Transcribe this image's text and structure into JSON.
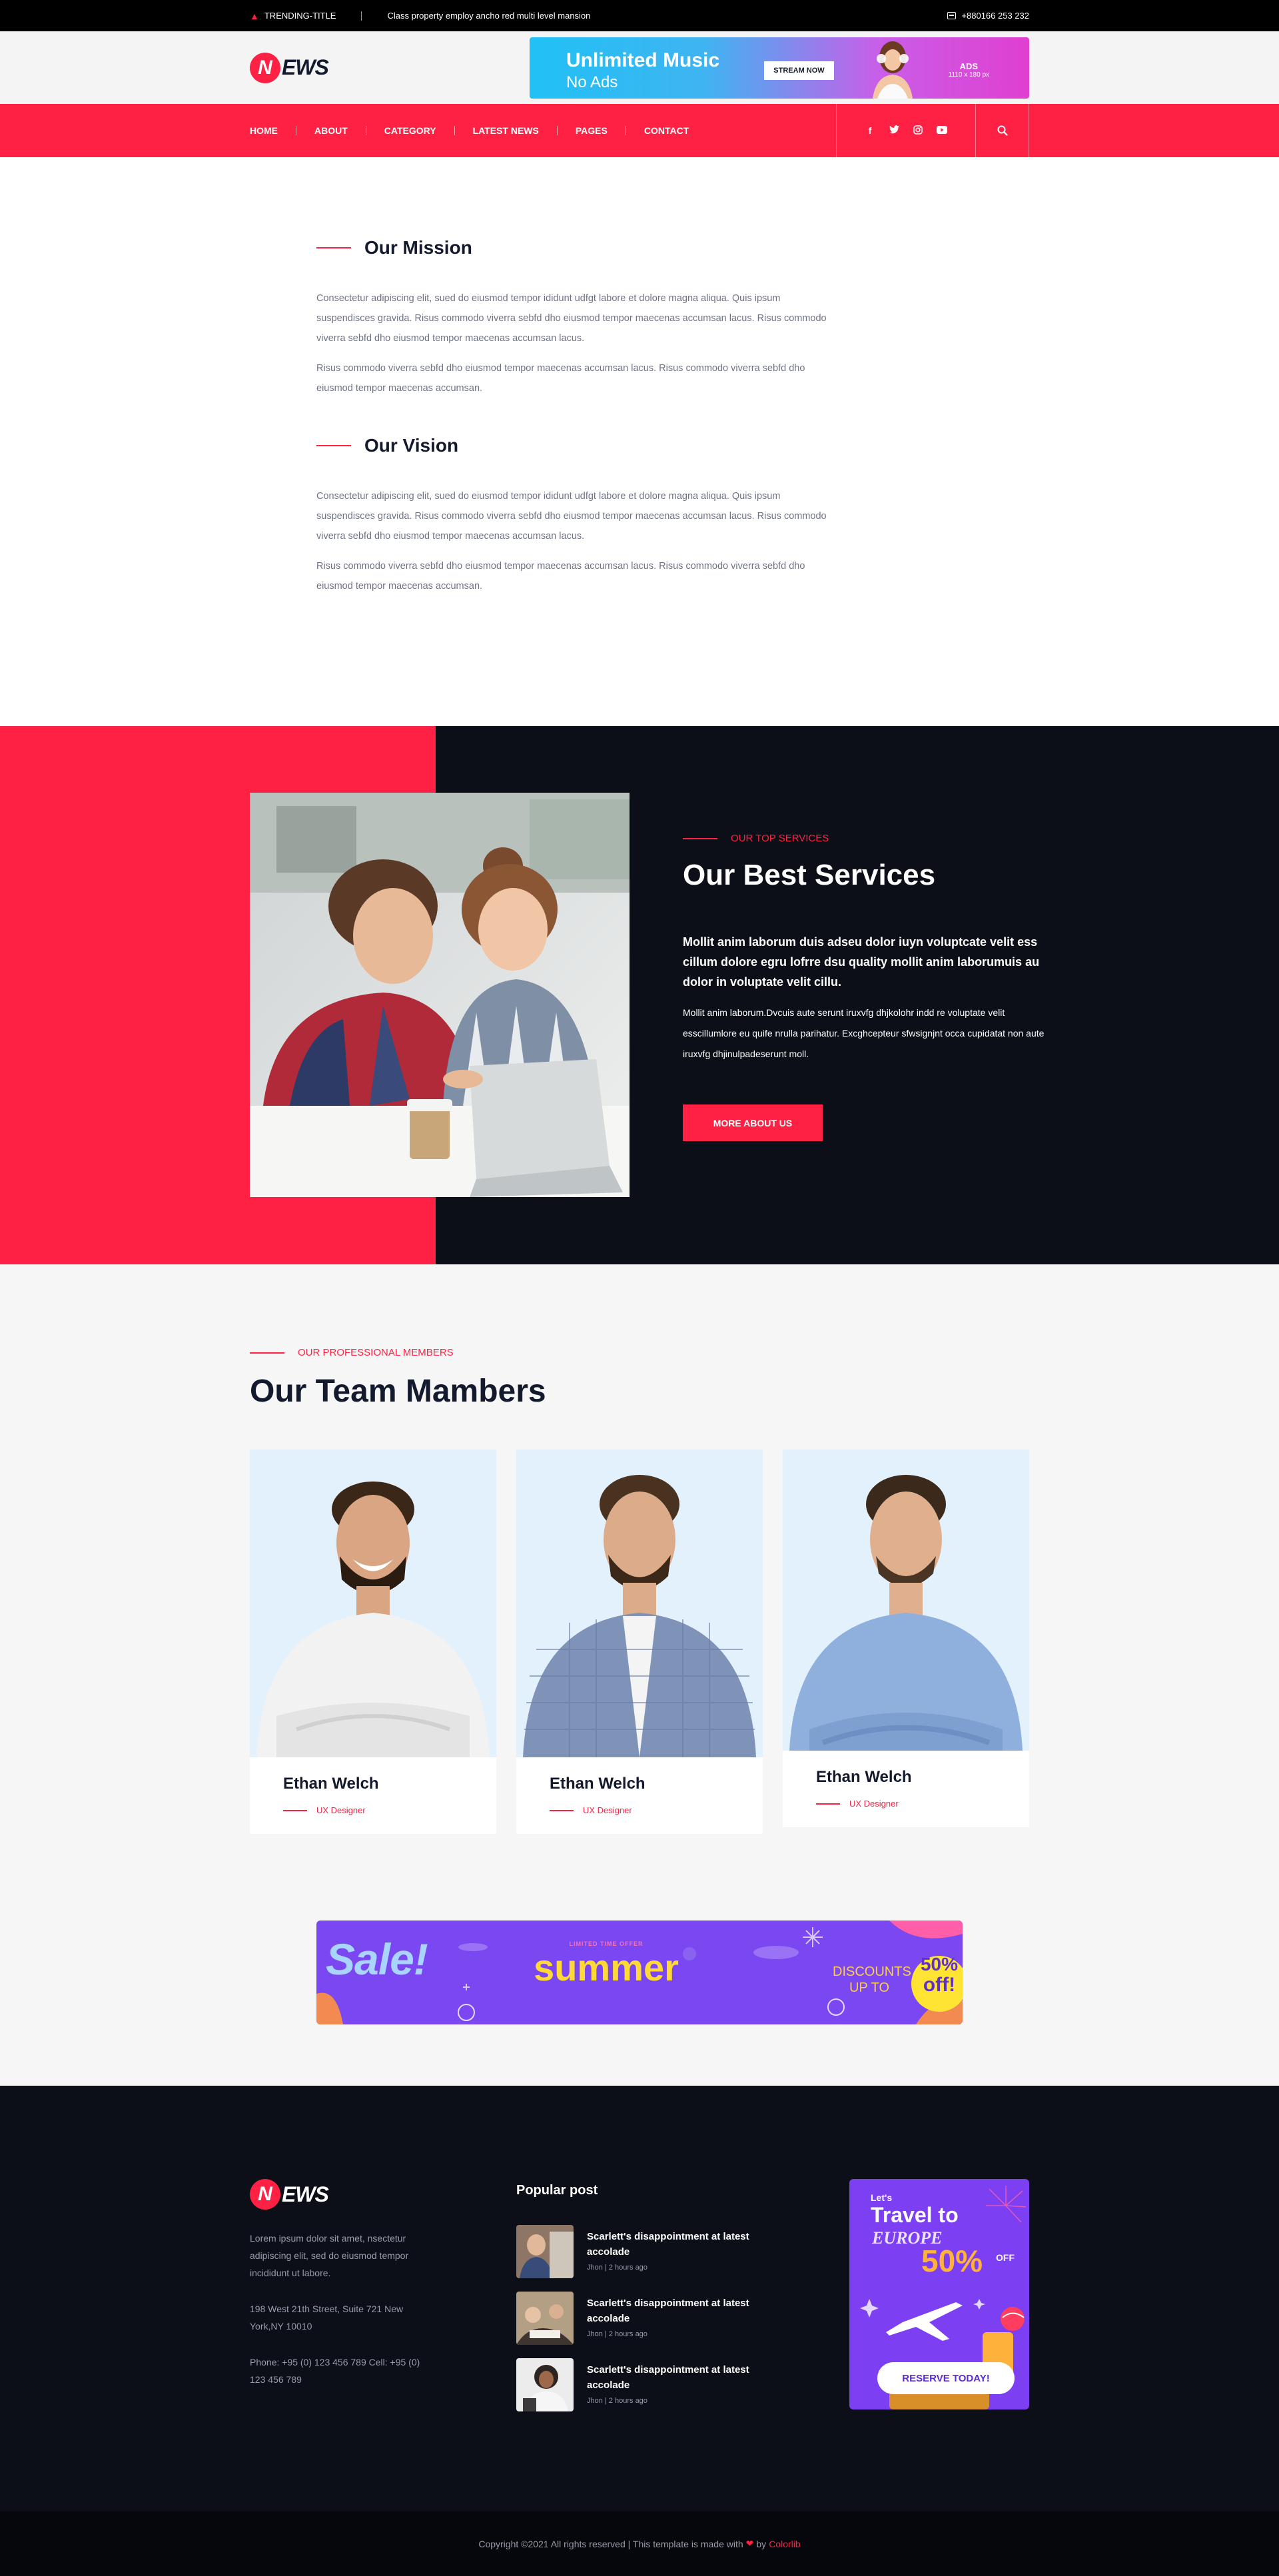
{
  "topbar": {
    "trending_label": "TRENDING-TITLE",
    "trending_text": "Class property employ ancho red multi level mansion",
    "phone": "+880166 253 232"
  },
  "header": {
    "logo_letter": "N",
    "logo_rest": "EWS",
    "ad": {
      "title": "Unlimited Music",
      "subtitle": "No Ads",
      "button": "STREAM NOW",
      "label": "ADS",
      "size": "1110 x 180 px"
    }
  },
  "nav": {
    "items": [
      {
        "label": "HOME"
      },
      {
        "label": "ABOUT"
      },
      {
        "label": "CATEGORY"
      },
      {
        "label": "LATEST NEWS"
      },
      {
        "label": "PAGES"
      },
      {
        "label": "CONTACT"
      }
    ],
    "socials": [
      "f",
      "t",
      "i",
      "y"
    ]
  },
  "about": {
    "mission": {
      "title": "Our Mission",
      "p1": "Consectetur adipiscing elit, sued do eiusmod tempor ididunt udfgt labore et dolore magna aliqua. Quis ipsum suspendisces gravida. Risus commodo viverra sebfd dho eiusmod tempor maecenas accumsan lacus. Risus commodo viverra sebfd dho eiusmod tempor maecenas accumsan lacus.",
      "p2": "Risus commodo viverra sebfd dho eiusmod tempor maecenas accumsan lacus. Risus commodo viverra sebfd dho eiusmod tempor maecenas accumsan."
    },
    "vision": {
      "title": "Our Vision",
      "p1": "Consectetur adipiscing elit, sued do eiusmod tempor ididunt udfgt labore et dolore magna aliqua. Quis ipsum suspendisces gravida. Risus commodo viverra sebfd dho eiusmod tempor maecenas accumsan lacus. Risus commodo viverra sebfd dho eiusmod tempor maecenas accumsan lacus.",
      "p2": "Risus commodo viverra sebfd dho eiusmod tempor maecenas accumsan lacus. Risus commodo viverra sebfd dho eiusmod tempor maecenas accumsan."
    }
  },
  "services": {
    "kicker": "OUR TOP SERVICES",
    "title": "Our Best Services",
    "lead": "Mollit anim laborum duis adseu dolor iuyn voluptcate velit ess cillum dolore egru lofrre dsu quality mollit anim laborumuis au dolor in voluptate velit cillu.",
    "desc": "Mollit anim laborum.Dvcuis aute serunt iruxvfg dhjkolohr indd re voluptate velit esscillumlore eu quife nrulla parihatur. Excghcepteur sfwsignjnt occa cupidatat non aute iruxvfg dhjinulpadeserunt moll.",
    "button": "MORE ABOUT US"
  },
  "team": {
    "kicker": "OUR PROFESSIONAL MEMBERS",
    "title": "Our Team Mambers",
    "members": [
      {
        "name": "Ethan Welch",
        "role": "UX Designer"
      },
      {
        "name": "Ethan Welch",
        "role": "UX Designer"
      },
      {
        "name": "Ethan Welch",
        "role": "UX Designer"
      }
    ]
  },
  "sale_banner": {
    "sale": "Sale!",
    "limited": "LIMITED TIME OFFER",
    "season": "summer",
    "discounts": "DISCOUNTS",
    "upto": "UP TO",
    "percent": "50%",
    "off": "off!"
  },
  "footer": {
    "about": "Lorem ipsum dolor sit amet, nsectetur adipiscing elit, sed do eiusmod tempor incididunt ut labore.",
    "address": "198 West 21th Street, Suite 721 New York,NY 10010",
    "phone": "Phone: +95 (0) 123 456 789 Cell: +95 (0) 123 456 789",
    "popular_title": "Popular post",
    "posts": [
      {
        "title": "Scarlett's disappointment at latest accolade",
        "meta": "Jhon | 2 hours ago"
      },
      {
        "title": "Scarlett's disappointment at latest accolade",
        "meta": "Jhon | 2 hours ago"
      },
      {
        "title": "Scarlett's disappointment at latest accolade",
        "meta": "Jhon | 2 hours ago"
      }
    ],
    "ad": {
      "lets": "Let's",
      "travel": "Travel to",
      "europe": "EUROPE",
      "percent": "50%",
      "off": "OFF",
      "button": "RESERVE TODAY!"
    }
  },
  "copyright": {
    "text": "Copyright ©2021 All rights reserved | This template is made with",
    "by": "by",
    "brand": "Colorlib"
  },
  "colors": {
    "accent": "#ff2143",
    "dark": "#0c0f18",
    "purple": "#7b47f0"
  }
}
